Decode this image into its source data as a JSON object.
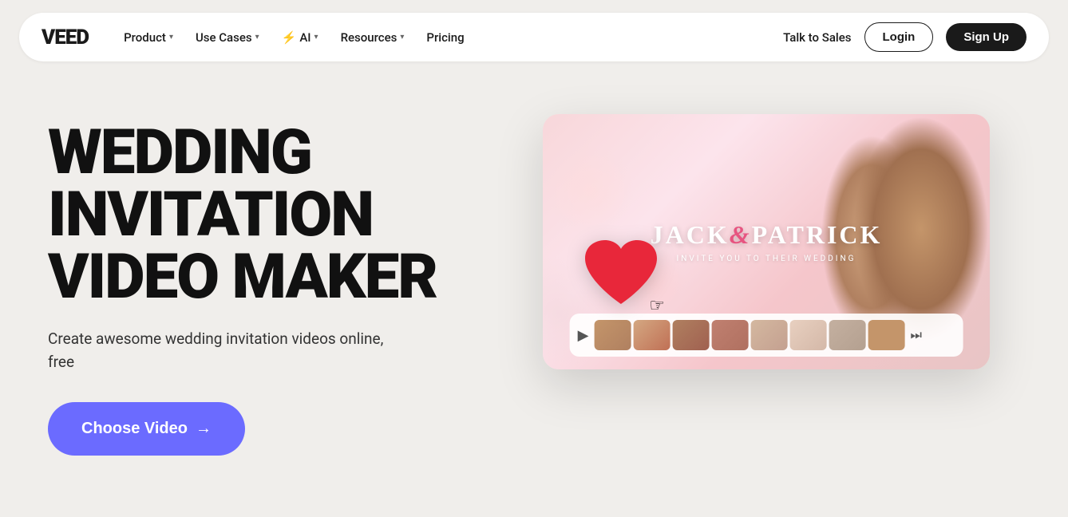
{
  "logo": {
    "text": "VEED"
  },
  "navbar": {
    "links": [
      {
        "label": "Product",
        "hasChevron": true,
        "hasIcon": false
      },
      {
        "label": "Use Cases",
        "hasChevron": true,
        "hasIcon": false
      },
      {
        "label": "AI",
        "hasChevron": true,
        "hasIcon": true
      },
      {
        "label": "Resources",
        "hasChevron": true,
        "hasIcon": false
      },
      {
        "label": "Pricing",
        "hasChevron": false,
        "hasIcon": false
      }
    ],
    "talk_to_sales": "Talk to Sales",
    "login": "Login",
    "signup": "Sign Up"
  },
  "hero": {
    "headline_line1": "WEDDING INVITATION",
    "headline_line2": "VIDEO MAKER",
    "subtext": "Create awesome wedding invitation videos online,\nfree",
    "cta_button": "Choose Video →"
  },
  "video_preview": {
    "couple_name": "JACK",
    "ampersand": "&",
    "partner_name": "PATRICK",
    "subtitle": "INVITE YOU TO THEIR WEDDING"
  }
}
